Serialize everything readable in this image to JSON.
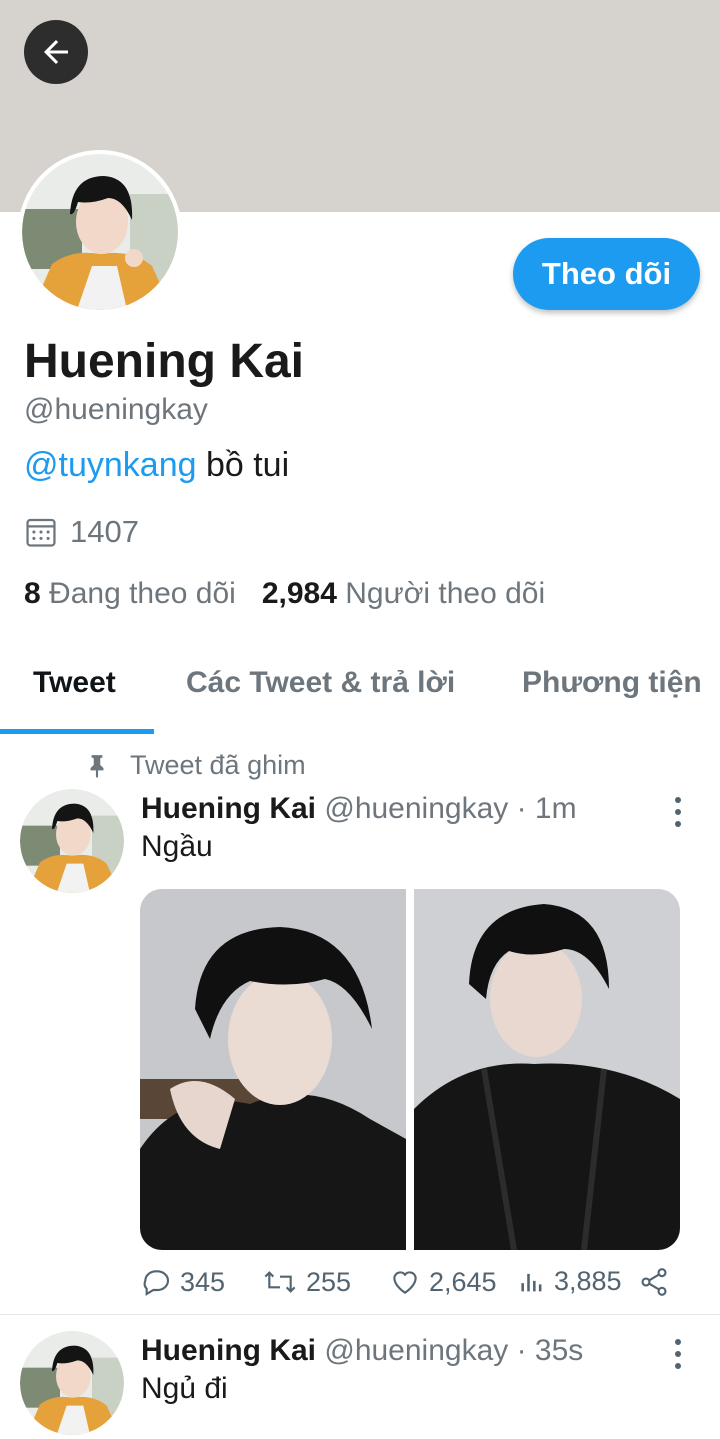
{
  "profile": {
    "display_name": "Huening Kai",
    "handle": "@hueningkay",
    "bio_mention": "@tuynkang",
    "bio_text": " bồ tui",
    "joined": "1407",
    "following_count": "8",
    "following_label": "Đang theo dõi",
    "followers_count": "2,984",
    "followers_label": "Người theo dõi",
    "follow_button": "Theo dõi"
  },
  "icons": {
    "back": "arrow-left-icon",
    "calendar": "calendar-icon",
    "pin": "pin-icon",
    "reply": "reply-icon",
    "retweet": "retweet-icon",
    "like": "heart-icon",
    "views": "analytics-icon",
    "share": "share-icon",
    "more": "more-vertical-icon"
  },
  "tabs": [
    {
      "label": "Tweet",
      "active": true
    },
    {
      "label": "Các Tweet & trả lời",
      "active": false
    },
    {
      "label": "Phương tiện",
      "active": false
    }
  ],
  "pinned_label": "Tweet đã ghim",
  "tweets": [
    {
      "name": "Huening Kai",
      "meta": "@hueningkay · 1m",
      "text": "Ngầu",
      "replies": "345",
      "retweets": "255",
      "likes": "2,645",
      "views": "3,885"
    },
    {
      "name": "Huening Kai",
      "meta": "@hueningkay · 35s",
      "text": "Ngủ đi"
    }
  ],
  "colors": {
    "accent": "#1d9bf0",
    "banner": "#d6d3ce",
    "text_secondary": "#6e767d"
  }
}
